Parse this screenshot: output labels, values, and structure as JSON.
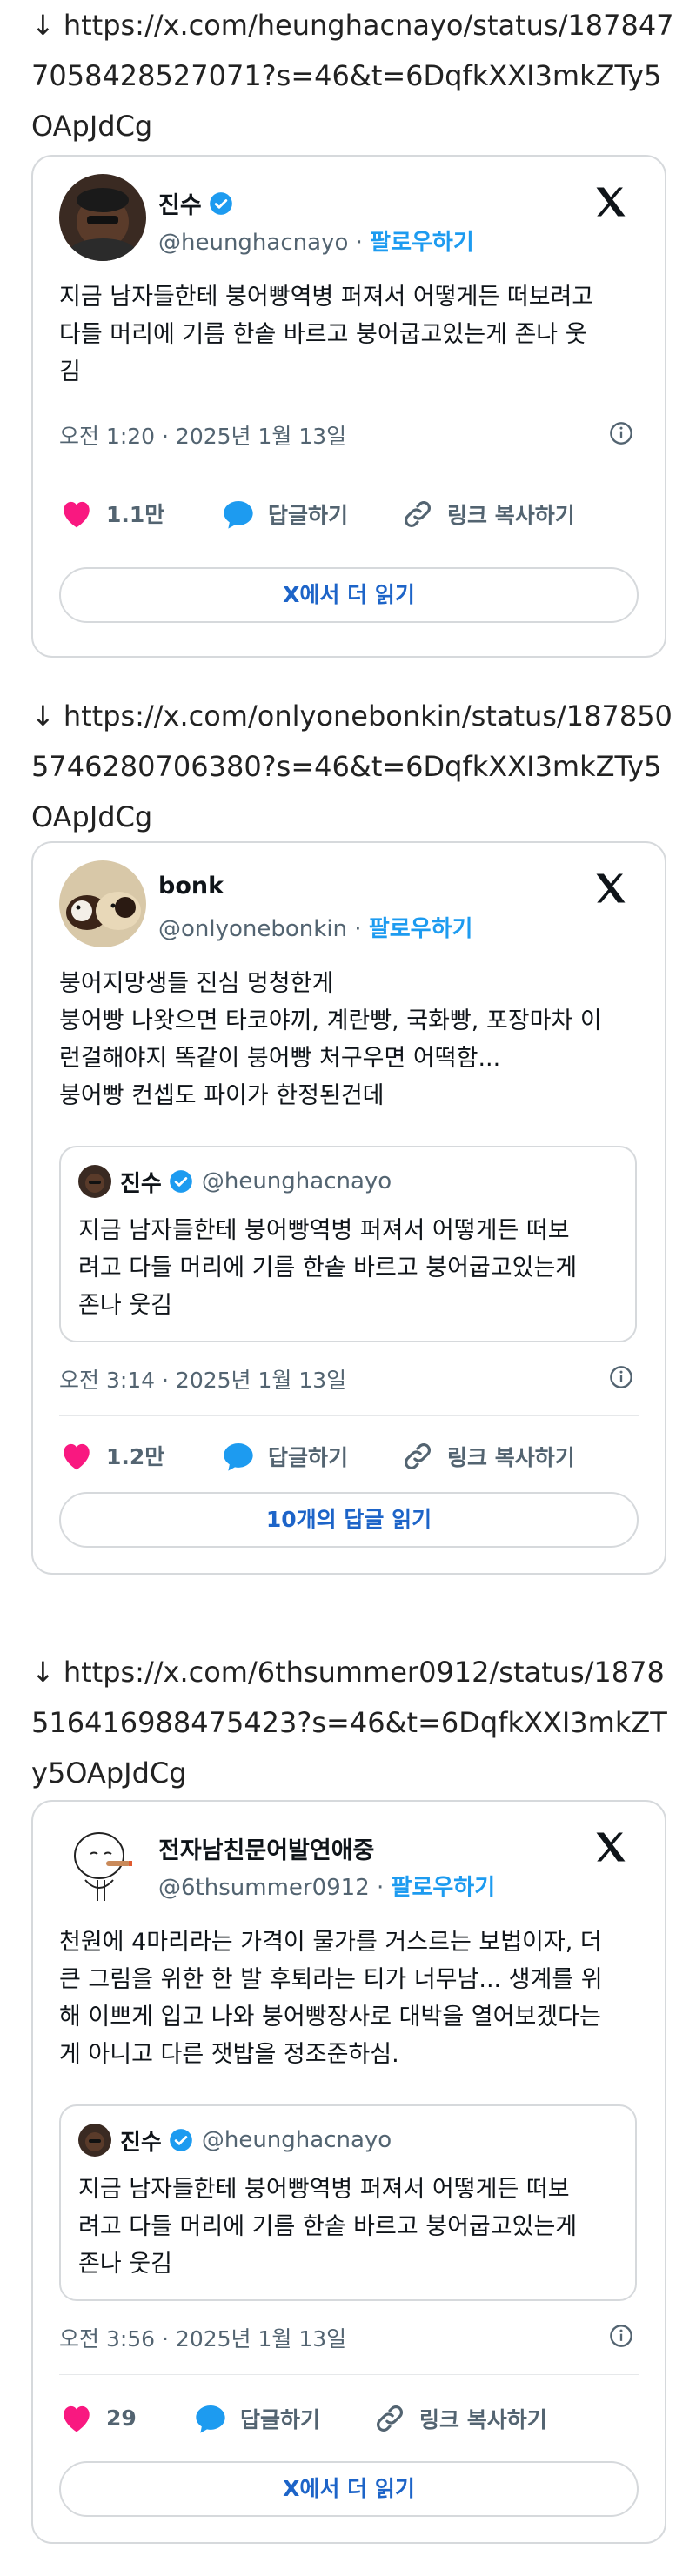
{
  "posts": [
    {
      "link": "https://x.com/heunghacnayo/status/1878477058428527071?s=46&t=6DqfkXXI3mkZTy5OApJdCg",
      "tweet": {
        "name": "진수",
        "handle": "@heunghacnayo",
        "follow_label": "팔로우하기",
        "text_lines": [
          "지금 남자들한테 붕어빵역병 퍼져서 어떻게든 떠보려고",
          "다들 머리에 기름 한솥 바르고 붕어굽고있는게 존나 웃",
          "김"
        ],
        "timestamp": "오전 1:20 · 2025년 1월 13일",
        "likes": "1.1만",
        "reply_label": "답글하기",
        "copy_label": "링크 복사하기",
        "cta": "X에서 더 읽기"
      }
    },
    {
      "link": "https://x.com/onlyonebonkin/status/1878505746280706380?s=46&t=6DqfkXXI3mkZTy5OApJdCg",
      "tweet": {
        "name": "bonk",
        "handle": "@onlyonebonkin",
        "follow_label": "팔로우하기",
        "text_lines": [
          "붕어지망생들 진심 멍청한게",
          "붕어빵 나왓으면 타코야끼, 계란빵, 국화빵, 포장마차 이",
          "런걸해야지 똑같이 붕어빵 처구우면 어떡함...",
          "붕어빵 컨셉도 파이가 한정된건데"
        ],
        "quote": {
          "name": "진수",
          "handle": "@heunghacnayo",
          "text_lines": [
            "지금 남자들한테 붕어빵역병 퍼져서 어떻게든 떠보",
            "려고 다들 머리에 기름 한솥 바르고 붕어굽고있는게",
            "존나 웃김"
          ]
        },
        "timestamp": "오전 3:14 · 2025년 1월 13일",
        "likes": "1.2만",
        "reply_label": "답글하기",
        "copy_label": "링크 복사하기",
        "cta": "10개의 답글 읽기"
      }
    },
    {
      "link": "https://x.com/6thsummer0912/status/1878516416988475423?s=46&t=6DqfkXXI3mkZTy5OApJdCg",
      "tweet": {
        "name": "전자남친문어발연애중",
        "handle": "@6thsummer0912",
        "follow_label": "팔로우하기",
        "text_lines": [
          "천원에 4마리라는 가격이 물가를 거스르는 보법이자, 더",
          "큰 그림을 위한 한 발 후퇴라는 티가 너무남... 생계를 위",
          "해 이쁘게 입고 나와 붕어빵장사로 대박을 열어보겠다는",
          "게 아니고 다른 잿밥을 정조준하심."
        ],
        "quote": {
          "name": "진수",
          "handle": "@heunghacnayo",
          "text_lines": [
            "지금 남자들한테 붕어빵역병 퍼져서 어떻게든 떠보",
            "려고 다들 머리에 기름 한솥 바르고 붕어굽고있는게",
            "존나 웃김"
          ]
        },
        "timestamp": "오전 3:56 · 2025년 1월 13일",
        "likes": "29",
        "reply_label": "답글하기",
        "copy_label": "링크 복사하기",
        "cta": "X에서 더 읽기"
      }
    }
  ],
  "arrow_glyph": "↓",
  "colors": {
    "accent": "#1d9bf0",
    "heart": "#f91880",
    "border": "#d6d9dc",
    "muted": "#536471"
  },
  "icons": [
    "down-arrow-icon",
    "verified-badge-icon",
    "x-logo-icon",
    "info-icon",
    "heart-icon",
    "reply-bubble-icon",
    "link-icon"
  ]
}
